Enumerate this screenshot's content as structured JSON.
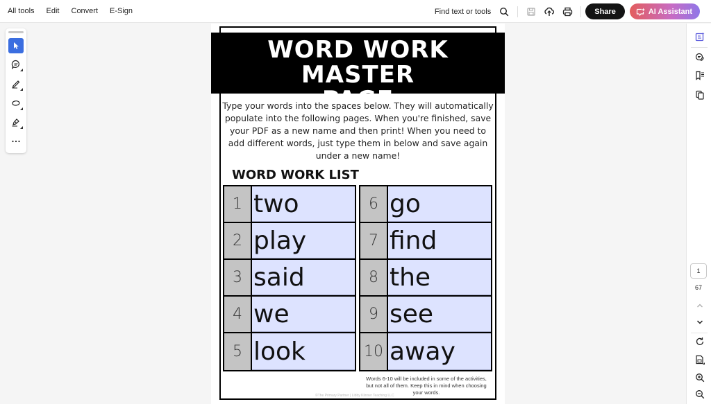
{
  "topbar": {
    "menu": [
      "All tools",
      "Edit",
      "Convert",
      "E-Sign"
    ],
    "find_label": "Find text or tools",
    "share_label": "Share",
    "ai_label": "AI Assistant",
    "icons": [
      "search-icon",
      "save-icon",
      "upload-icon",
      "print-icon"
    ]
  },
  "left_tools": [
    "select-icon",
    "comment-icon",
    "draw-icon",
    "lasso-icon",
    "sign-icon",
    "more-icon"
  ],
  "right_rail": {
    "icons": [
      "ai-panel-icon",
      "comments-icon",
      "bookmarks-icon",
      "pages-icon"
    ],
    "current_page": "1",
    "total_pages": "67",
    "bottom_icons": [
      "page-up-icon",
      "page-down-icon",
      "rotate-icon",
      "fit-page-icon",
      "zoom-in-icon",
      "zoom-out-icon"
    ]
  },
  "document": {
    "title": "WORD WORK MASTER PAGE",
    "title_line1": "WORD WORK MASTER",
    "title_line2": "PAGE",
    "intro": "Type your words into the spaces below. They will automatically populate into the following pages. When you're finished, save your PDF as a new name and then print! When you need to add different words, just type them in below and save again under a new name!",
    "list_heading": "WORD WORK LIST",
    "words_left": [
      {
        "num": "1",
        "word": "two"
      },
      {
        "num": "2",
        "word": "play"
      },
      {
        "num": "3",
        "word": "said"
      },
      {
        "num": "4",
        "word": "we"
      },
      {
        "num": "5",
        "word": "look"
      }
    ],
    "words_right": [
      {
        "num": "6",
        "word": "go"
      },
      {
        "num": "7",
        "word": "find"
      },
      {
        "num": "8",
        "word": "the"
      },
      {
        "num": "9",
        "word": "see"
      },
      {
        "num": "10",
        "word": "away"
      }
    ],
    "note": "Words 6-10 will be included in some of the activities, but not all of them. Keep this in mind when choosing your words.",
    "copyright": "©The Primary Partner | Libby Klinner Teaching LLC"
  },
  "colors": {
    "accent": "#3b6ee0",
    "field_fill": "#dde3ff",
    "number_fill": "#c4c4c4"
  }
}
